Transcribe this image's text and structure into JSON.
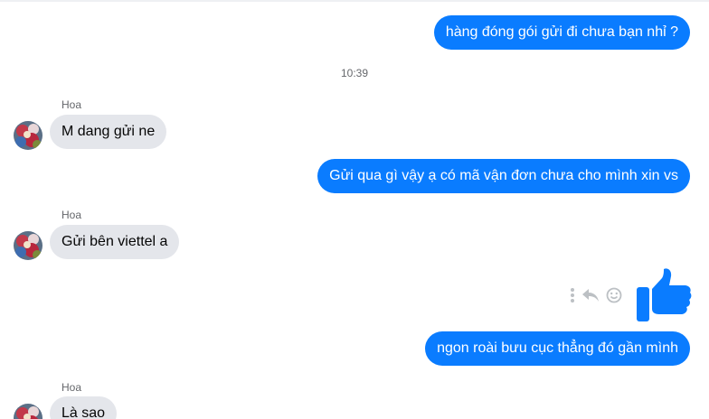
{
  "accent_color": "#0a7cff",
  "incoming_bubble_color": "#e4e6eb",
  "timestamp": "10:39",
  "messages": [
    {
      "direction": "outgoing",
      "text": "hàng đóng gói gửi đi chưa bạn nhỉ ?"
    },
    {
      "direction": "incoming",
      "sender": "Hoa",
      "text": "M dang gửi ne"
    },
    {
      "direction": "outgoing",
      "text": "Gửi qua gì vậy ạ có mã vận đơn chưa cho mình xin vs"
    },
    {
      "direction": "incoming",
      "sender": "Hoa",
      "text": "Gửi bên viettel a"
    },
    {
      "direction": "outgoing",
      "sticker": "thumbs-up-icon"
    },
    {
      "direction": "outgoing",
      "text": "ngon roài bưu cục thẳng đó gần mình"
    },
    {
      "direction": "incoming",
      "sender": "Hoa",
      "text": "Là sao"
    }
  ],
  "hover_actions": [
    "more-options-icon",
    "reply-icon",
    "react-emoji-icon"
  ]
}
